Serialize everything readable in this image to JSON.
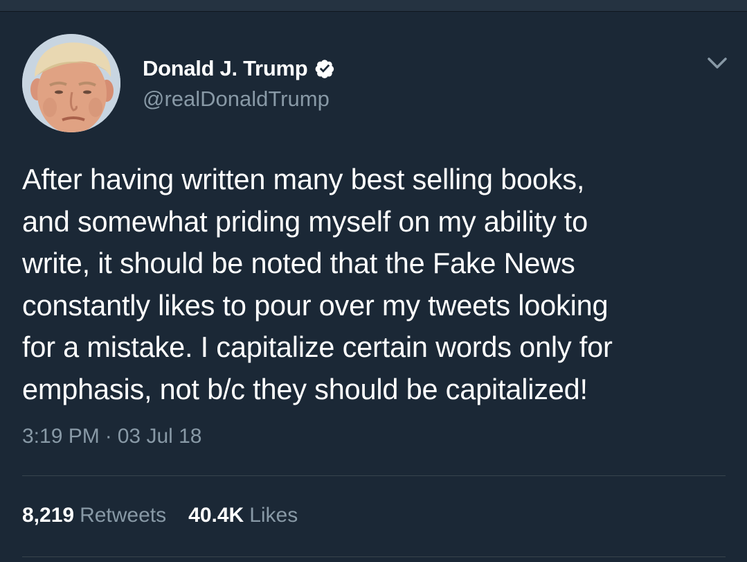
{
  "tweet": {
    "author": {
      "display_name": "Donald J. Trump",
      "handle": "@realDonaldTrump",
      "verified": true,
      "avatar": "profile-photo"
    },
    "text": "After having written many best selling books,\nand somewhat priding myself on my ability to\nwrite, it should be noted that the Fake News\nconstantly likes to pour over my tweets looking\nfor a mistake. I capitalize certain words only for\nemphasis, not b/c they should be capitalized!",
    "time": "3:19 PM",
    "date": "03 Jul 18",
    "separator": "·",
    "stats": {
      "retweets_count": "8,219",
      "retweets_label": "Retweets",
      "likes_count": "40.4K",
      "likes_label": "Likes"
    },
    "menu_icon": "chevron-down-icon",
    "verified_icon": "verified-badge-icon"
  },
  "colors": {
    "background": "#1b2836",
    "text_primary": "#ffffff",
    "text_secondary": "#8899a6",
    "divider": "#38444d"
  }
}
